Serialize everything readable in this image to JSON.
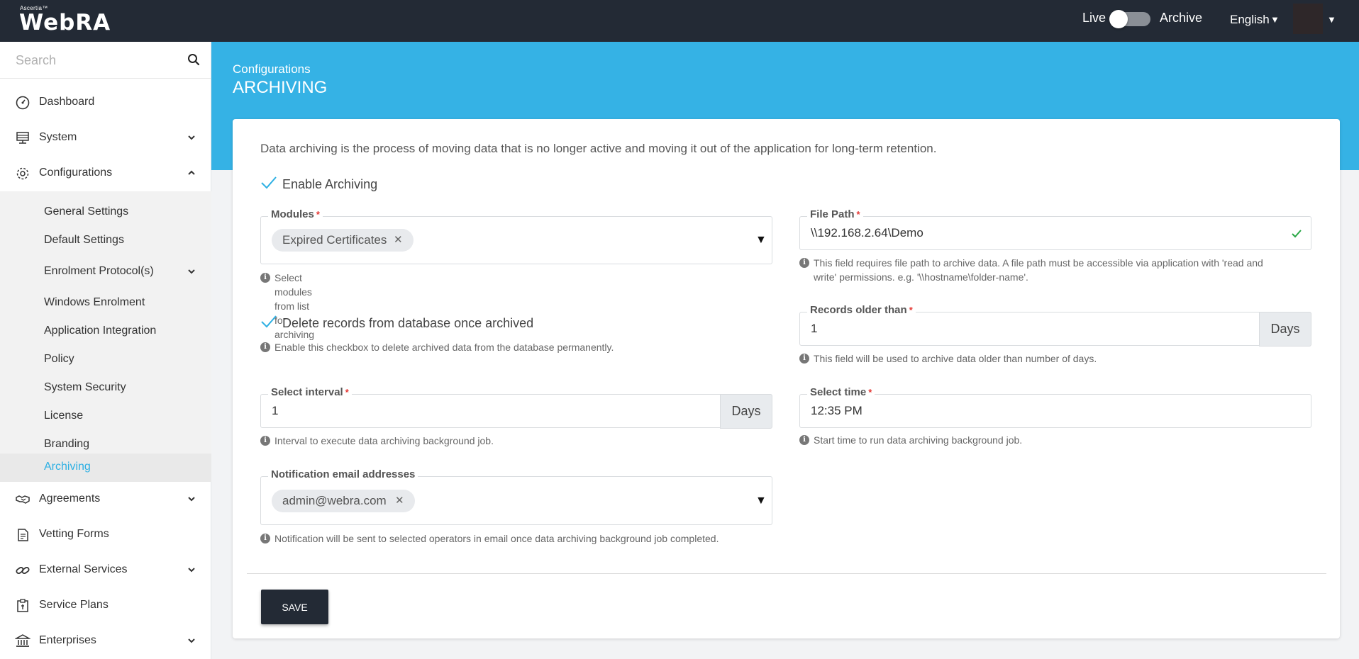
{
  "topbar": {
    "brand_small": "Ascertia™",
    "brand": "WebRA",
    "live_label": "Live",
    "archive_label": "Archive",
    "language": "English"
  },
  "sidebar": {
    "search_placeholder": "Search",
    "items": [
      {
        "label": "Dashboard",
        "icon": "dashboard-icon"
      },
      {
        "label": "System",
        "icon": "server-icon"
      },
      {
        "label": "Configurations",
        "icon": "gear-icon"
      },
      {
        "label": "Agreements",
        "icon": "handshake-icon"
      },
      {
        "label": "Vetting Forms",
        "icon": "form-icon"
      },
      {
        "label": "External Services",
        "icon": "link-icon"
      },
      {
        "label": "Service Plans",
        "icon": "service-plan-icon"
      },
      {
        "label": "Enterprises",
        "icon": "bank-icon"
      }
    ],
    "sub_items": [
      "General Settings",
      "Default Settings",
      "Enrolment Protocol(s)",
      "Windows Enrolment",
      "Application Integration",
      "Policy",
      "System Security",
      "License",
      "Branding",
      "Archiving"
    ]
  },
  "header": {
    "breadcrumb": "Configurations",
    "title": "ARCHIVING"
  },
  "form": {
    "intro": "Data archiving is the process of moving data that is no longer active and moving it out of the application for long-term retention.",
    "enable_archiving": "Enable Archiving",
    "modules": {
      "label": "Modules",
      "chip": "Expired Certificates",
      "help": "Select modules from list for archiving"
    },
    "file_path": {
      "label": "File Path",
      "value": "\\\\192.168.2.64\\Demo",
      "help_line1": "This field requires file path to archive data. A file path must be accessible via application with 'read and",
      "help_line2": "write' permissions. e.g. '\\\\hostname\\folder-name'."
    },
    "delete_records": "Delete records from database once archived",
    "delete_help": "Enable this checkbox to delete archived data from the database permanently.",
    "records_older": {
      "label": "Records older than",
      "value": "1",
      "unit": "Days",
      "help": "This field will be used to archive data older than number of days."
    },
    "interval": {
      "label": "Select interval",
      "value": "1",
      "unit": "Days",
      "help": "Interval to execute data archiving background job."
    },
    "time": {
      "label": "Select time",
      "value": "12:35 PM",
      "help": "Start time to run data archiving background job."
    },
    "notification": {
      "label": "Notification email addresses",
      "chip": "admin@webra.com",
      "help": "Notification will be sent to selected operators in email once data archiving background job completed."
    },
    "required_mark": "*",
    "save_label": "SAVE"
  }
}
